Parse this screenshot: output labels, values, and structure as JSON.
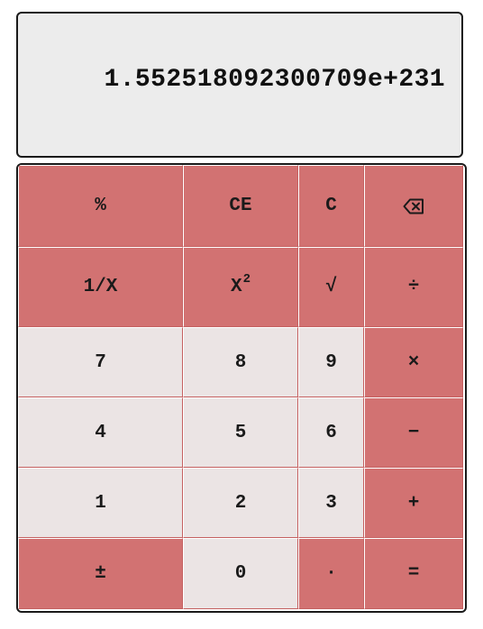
{
  "display": {
    "value": "1.552518092300709e+231"
  },
  "keys": {
    "percent": "%",
    "clear_entry": "CE",
    "clear": "C",
    "backspace_icon": "backspace-icon",
    "reciprocal": "1/X",
    "square_base": "X",
    "square_exp": "2",
    "sqrt": "√",
    "divide": "÷",
    "seven": "7",
    "eight": "8",
    "nine": "9",
    "multiply": "×",
    "four": "4",
    "five": "5",
    "six": "6",
    "subtract": "−",
    "one": "1",
    "two": "2",
    "three": "3",
    "add": "+",
    "negate": "±",
    "zero": "0",
    "decimal": "·",
    "equals": "="
  },
  "colors": {
    "operator_key": "#d27272",
    "number_key": "#ebe4e4",
    "display_bg": "#ececec",
    "border": "#1a1a1a"
  }
}
